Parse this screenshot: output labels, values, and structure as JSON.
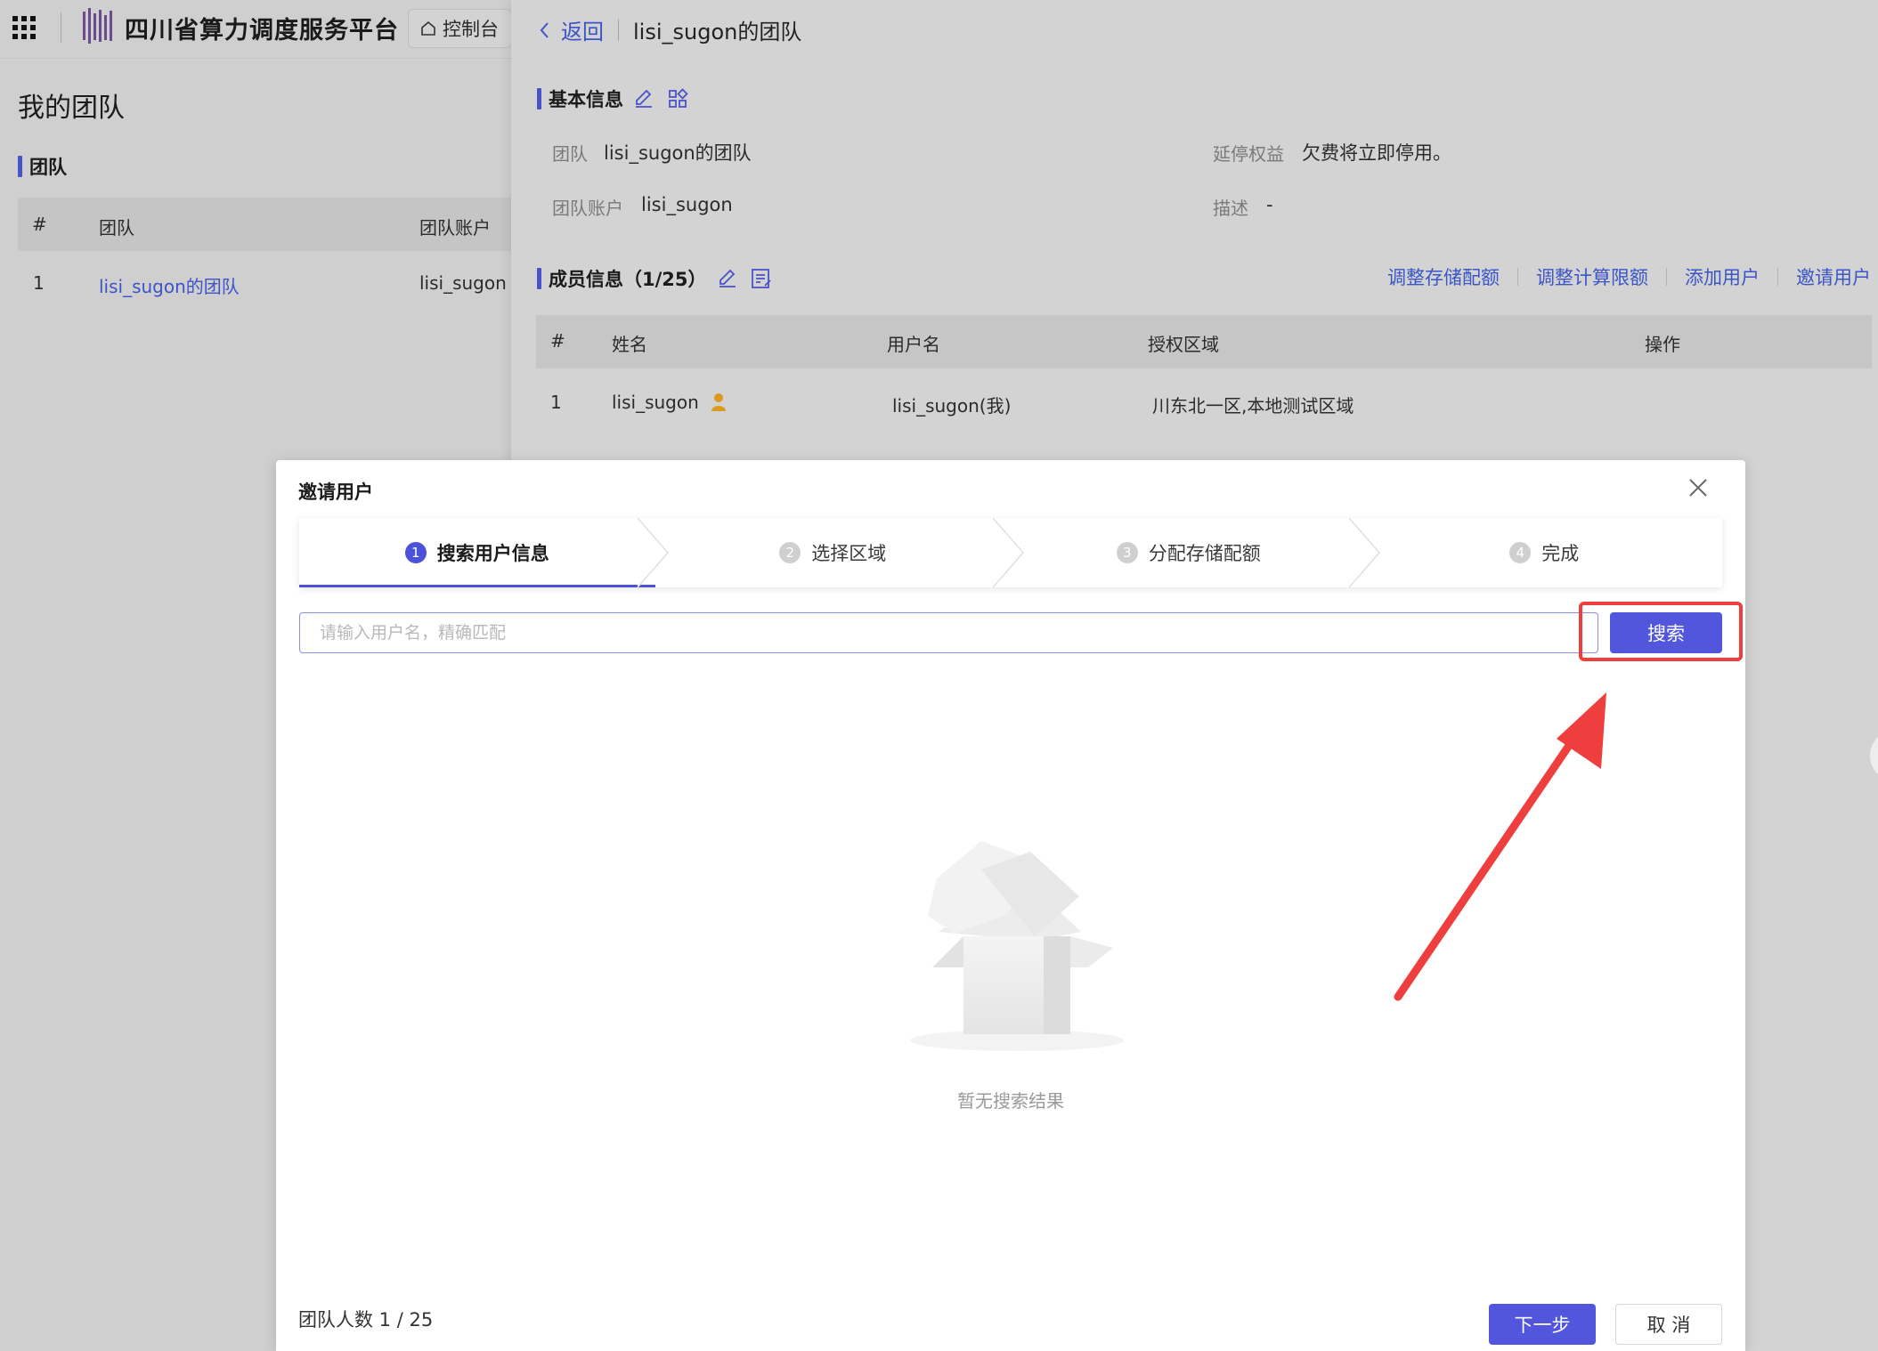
{
  "topbar": {
    "platform_title": "四川省算力调度服务平台",
    "console_label": "控制台"
  },
  "left_page": {
    "title": "我的团队",
    "section_title": "团队",
    "table": {
      "headers": [
        "#",
        "团队",
        "团队账户"
      ],
      "rows": [
        {
          "index": "1",
          "team": "lisi_sugon的团队",
          "account": "lisi_sugon"
        }
      ]
    }
  },
  "drawer": {
    "back_label": "返回",
    "title": "lisi_sugon的团队",
    "basic_info": {
      "section_title": "基本信息",
      "team_label": "团队",
      "team_value": "lisi_sugon的团队",
      "account_label": "团队账户",
      "account_value": "lisi_sugon",
      "grace_label": "延停权益",
      "grace_value": "欠费将立即停用。",
      "desc_label": "描述",
      "desc_value": "-"
    },
    "members": {
      "section_title": "成员信息（1/25）",
      "actions": [
        "调整存储配额",
        "调整计算限额",
        "添加用户",
        "邀请用户"
      ],
      "headers": [
        "#",
        "姓名",
        "用户名",
        "授权区域",
        "操作"
      ],
      "rows": [
        {
          "index": "1",
          "name": "lisi_sugon",
          "username": "lisi_sugon(我)",
          "regions": "川东北一区,本地测试区域"
        }
      ]
    }
  },
  "modal": {
    "title": "邀请用户",
    "steps": [
      {
        "num": "1",
        "label": "搜索用户信息",
        "active": true
      },
      {
        "num": "2",
        "label": "选择区域",
        "active": false
      },
      {
        "num": "3",
        "label": "分配存储配额",
        "active": false
      },
      {
        "num": "4",
        "label": "完成",
        "active": false
      }
    ],
    "search_placeholder": "请输入用户名，精确匹配",
    "search_value": "",
    "search_button": "搜索",
    "empty_text": "暂无搜索结果",
    "footer_count": "团队人数 1 / 25",
    "next_button": "下一步",
    "cancel_button": "取 消"
  },
  "colors": {
    "accent": "#5156dd",
    "link": "#3b55c7",
    "annotation": "#ee3e3e",
    "owner_badge": "#d99a1f"
  },
  "icons": [
    "apps-grid-icon",
    "brand-logo-icon",
    "home-icon",
    "chevron-left-icon",
    "edit-icon",
    "grid-view-icon",
    "list-edit-icon",
    "owner-badge-icon",
    "close-icon",
    "chevron-step-icon",
    "empty-box-icon",
    "arrow-annotation-icon"
  ]
}
